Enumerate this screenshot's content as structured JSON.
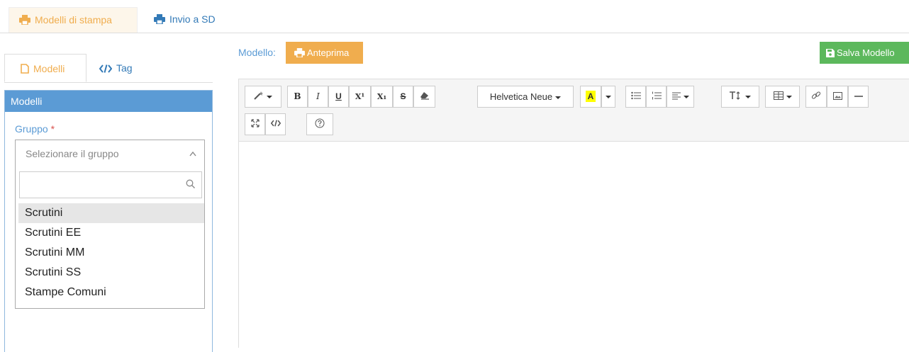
{
  "top_tabs": [
    {
      "label": "Modelli di stampa",
      "icon": "printer-icon",
      "active": true
    },
    {
      "label": "Invio a SD",
      "icon": "printer-icon",
      "active": false
    }
  ],
  "left_tabs": [
    {
      "label": "Modelli",
      "icon": "file-icon",
      "active": true
    },
    {
      "label": "Tag",
      "icon": "code-icon",
      "active": false
    }
  ],
  "panel": {
    "title": "Modelli",
    "group_label": "Gruppo",
    "required_mark": "*",
    "select_placeholder": "Selezionare il gruppo",
    "search_value": "",
    "options": [
      "Scrutini",
      "Scrutini EE",
      "Scrutini MM",
      "Scrutini SS",
      "Stampe Comuni"
    ],
    "highlighted_option": "Scrutini"
  },
  "editor_header": {
    "modello_label": "Modello:",
    "preview_label": "Anteprima",
    "save_label": "Salva Modello"
  },
  "toolbar": {
    "font_name": "Helvetica Neue",
    "color_letter": "A",
    "bold": "B",
    "italic": "I",
    "underline": "U",
    "superscript": "X¹",
    "subscript": "X₁",
    "strike": "S"
  },
  "colors": {
    "orange": "#f0ad4e",
    "blue": "#337ab7",
    "panel_blue": "#5b9bd5",
    "green": "#5cb85c"
  }
}
